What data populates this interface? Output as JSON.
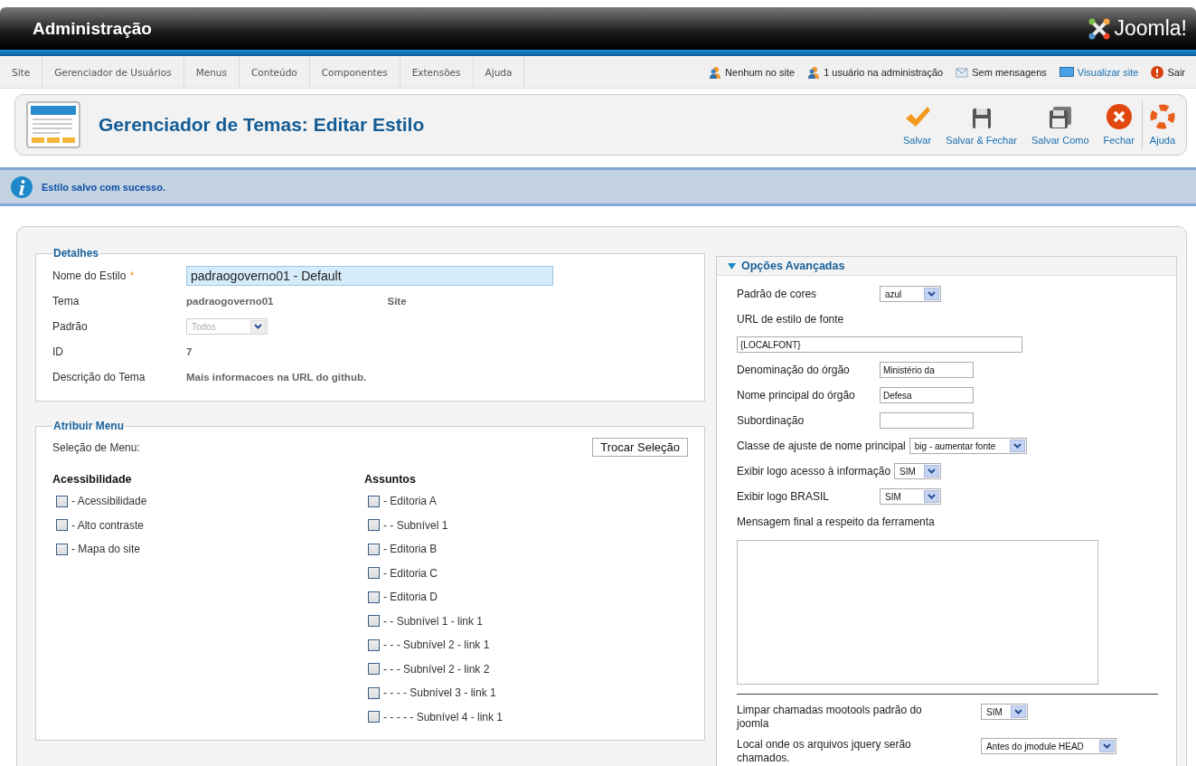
{
  "header": {
    "title": "Administração",
    "logo_text": "Joomla!"
  },
  "menu": [
    "Site",
    "Gerenciador de Usuários",
    "Menus",
    "Conteúdo",
    "Componentes",
    "Extensões",
    "Ajuda"
  ],
  "status": [
    {
      "kind": "users",
      "label": "Nenhum no site"
    },
    {
      "kind": "users",
      "label": "1 usuário na administração"
    },
    {
      "kind": "messages",
      "label": "Sem mensagens"
    },
    {
      "kind": "preview",
      "label": "Visualizar site"
    },
    {
      "kind": "logout",
      "label": "Sair"
    }
  ],
  "page_title": "Gerenciador de Temas: Editar Estilo",
  "toolbar": [
    {
      "kind": "save",
      "label": "Salvar"
    },
    {
      "kind": "save-close",
      "label": "Salvar & Fechar"
    },
    {
      "kind": "save-copy",
      "label": "Salvar Como"
    },
    {
      "kind": "close",
      "label": "Fechar"
    },
    {
      "kind": "help",
      "label": "Ajuda"
    }
  ],
  "message": "Estilo salvo com sucesso.",
  "details": {
    "legend": "Detalhes",
    "rows": [
      {
        "kind": "input",
        "label": "Nome do Estilo",
        "required_mark": "*",
        "value": "padraogoverno01 - Default"
      },
      {
        "kind": "text",
        "label": "Tema",
        "value": "padraogoverno01",
        "extra": "Site"
      },
      {
        "kind": "select",
        "label": "Padrão",
        "value": "Todos",
        "disabled": true
      },
      {
        "kind": "text",
        "label": "ID",
        "value": "7"
      },
      {
        "kind": "text",
        "label": "Descrição do Tema",
        "value": "Mais informacoes na URL do github."
      }
    ]
  },
  "menu_assignment": {
    "legend": "Atribuir Menu",
    "label": "Seleção de Menu:",
    "button": "Trocar Seleção",
    "groups": [
      {
        "title": "Acessibilidade",
        "items": [
          {
            "label": "- Acessibilidade",
            "checked": false
          },
          {
            "label": "- Alto contraste",
            "checked": false
          },
          {
            "label": "- Mapa do site",
            "checked": false
          }
        ]
      },
      {
        "title": "Assuntos",
        "items": [
          {
            "label": "- Editoria A",
            "checked": false
          },
          {
            "label": "- - Subnível 1",
            "checked": false
          },
          {
            "label": "- Editoria B",
            "checked": false
          },
          {
            "label": "- Editoria C",
            "checked": false
          },
          {
            "label": "- Editoria D",
            "checked": false
          },
          {
            "label": "- - Subnível 1 - link 1",
            "checked": false
          },
          {
            "label": "- - - Subnível 2 - link 1",
            "checked": false
          },
          {
            "label": "- - - Subnível 2 - link 2",
            "checked": false
          },
          {
            "label": "- - - - Subnível 3 - link 1",
            "checked": false
          },
          {
            "label": "- - - - - Subnível 4 - link 1",
            "checked": false
          }
        ]
      }
    ]
  },
  "advanced": {
    "title": "Opções Avançadas",
    "expanded": true,
    "fields": [
      {
        "kind": "select",
        "label": "Padrão de cores",
        "value": "azul"
      },
      {
        "kind": "input-below",
        "label": "URL de estilo de fonte",
        "value": "{LOCALFONT}"
      },
      {
        "kind": "input",
        "label": "Denominação do órgão",
        "value": "Ministério da"
      },
      {
        "kind": "input",
        "label": "Nome principal do órgão",
        "value": "Defesa"
      },
      {
        "kind": "input",
        "label": "Subordinação"
      },
      {
        "kind": "select-inline",
        "label": "Classe de ajuste de nome principal",
        "value": "big - aumentar fonte"
      },
      {
        "kind": "select-inline",
        "label": "Exibir logo acesso à informação",
        "value": "SIM"
      },
      {
        "kind": "select",
        "label": "Exibir logo BRASIL",
        "value": "SIM"
      },
      {
        "kind": "textarea",
        "label": "Mensagem final a respeito da ferramenta"
      }
    ],
    "extra_fields": [
      {
        "label": "Limpar chamadas mootools padrão do joomla",
        "value": "SIM"
      },
      {
        "label": "Local onde os arquivos jquery serão chamados.",
        "value": "Antes do jmodule HEAD"
      }
    ]
  }
}
